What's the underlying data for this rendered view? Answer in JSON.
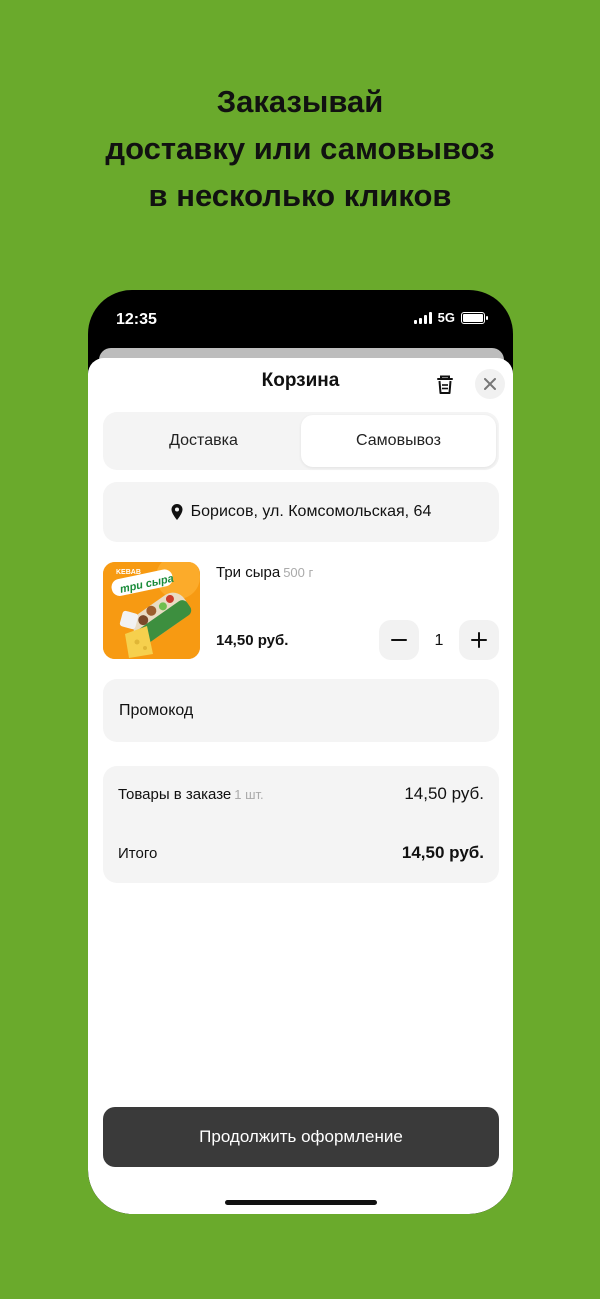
{
  "promo_headline": {
    "line1": "Заказывай",
    "line2": "доставку или самовывоз",
    "line3": "в несколько кликов"
  },
  "status_bar": {
    "time": "12:35",
    "network": "5G",
    "icons": [
      "signal-bars-icon",
      "battery-icon"
    ]
  },
  "cart": {
    "title": "Корзина",
    "icons": {
      "trash": "trash-icon",
      "close": "close-icon"
    },
    "tabs": [
      {
        "label": "Доставка",
        "selected": false
      },
      {
        "label": "Самовывоз",
        "selected": true
      }
    ],
    "address": "Борисов, ул. Комсомольская, 64",
    "address_icon": "location-pin-icon",
    "items": [
      {
        "image_label_top": "KEBAB",
        "image_label_main": "три сыра",
        "name": "Три сыра",
        "weight": "500 г",
        "price": "14,50 руб.",
        "quantity": "1"
      }
    ],
    "promo_label": "Промокод",
    "summary": {
      "items_label": "Товары в заказе",
      "items_count": "1 шт.",
      "items_value": "14,50 руб.",
      "total_label": "Итого",
      "total_value": "14,50 руб."
    },
    "continue_button": "Продолжить оформление"
  },
  "colors": {
    "background": "#6aaa2c",
    "button_dark": "#3a3a3a",
    "card_bg": "#f4f4f4",
    "product_orange": "#f58a00"
  }
}
